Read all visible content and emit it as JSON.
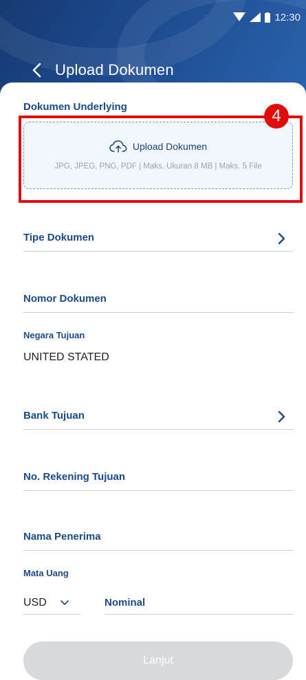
{
  "status_bar": {
    "time": "12:30"
  },
  "header": {
    "title": "Upload Dokumen"
  },
  "upload": {
    "section_label": "Dokumen Underlying",
    "button_label": "Upload Dokumen",
    "hint": "JPG, JPEG, PNG, PDF | Maks. Ukuran 8 MB | Maks. 5 File",
    "step_badge": "4"
  },
  "form": {
    "tipe_dokumen": {
      "label": "Tipe Dokumen"
    },
    "nomor_dokumen": {
      "label": "Nomor Dokumen"
    },
    "negara_tujuan": {
      "label": "Negara Tujuan",
      "value": "UNITED STATED"
    },
    "bank_tujuan": {
      "label": "Bank Tujuan"
    },
    "no_rekening": {
      "label": "No. Rekening Tujuan"
    },
    "nama_penerima": {
      "label": "Nama Penerima"
    },
    "mata_uang": {
      "label": "Mata Uang",
      "value": "USD"
    },
    "nominal": {
      "label": "Nominal"
    }
  },
  "actions": {
    "next_label": "Lanjut"
  },
  "colors": {
    "brand": "#1d4b8f",
    "accent": "#1b4a8a",
    "highlight": "#e10b0b",
    "disabled": "#d7d9dc"
  }
}
